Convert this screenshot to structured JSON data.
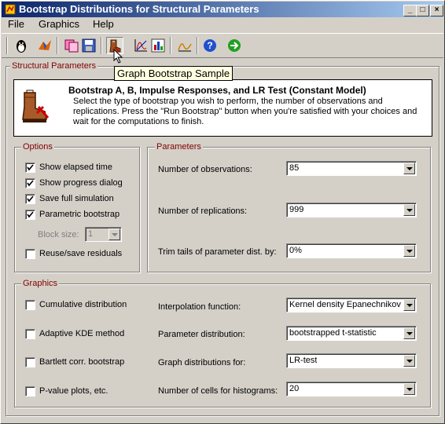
{
  "window": {
    "title": "Bootstrap Distributions for Structural Parameters",
    "controls": [
      "_",
      "□",
      "×"
    ]
  },
  "menu": [
    "File",
    "Graphics",
    "Help"
  ],
  "toolbar": {
    "icons": [
      "penguin-icon",
      "matlab-icon",
      "copy-icon",
      "save-icon",
      "bootstrap-icon",
      "graph-icon",
      "chart-icon",
      "distribution-icon",
      "help-icon",
      "run-icon"
    ],
    "tooltip": "Graph Bootstrap Sample"
  },
  "structural": {
    "group_label": "Structural Parameters",
    "title": "Bootstrap A, B, Impulse Responses, and LR Test (Constant Model)",
    "description": "Select the type of bootstrap you wish to perform, the number of observations and replications. Press the \"Run Bootstrap\" button when you're satisfied with your choices and wait for the computations to finish."
  },
  "options": {
    "group_label": "Options",
    "items": [
      {
        "label": "Show elapsed time",
        "checked": true
      },
      {
        "label": "Show progress dialog",
        "checked": true
      },
      {
        "label": "Save full simulation",
        "checked": true
      },
      {
        "label": "Parametric bootstrap",
        "checked": true
      }
    ],
    "block_size_label": "Block size:",
    "block_size_value": "1",
    "reuse_label": "Reuse/save residuals",
    "reuse_checked": false
  },
  "parameters": {
    "group_label": "Parameters",
    "fields": [
      {
        "label": "Number of observations:",
        "value": "85"
      },
      {
        "label": "Number of replications:",
        "value": "999"
      },
      {
        "label": "Trim tails of parameter dist. by:",
        "value": "0%"
      }
    ]
  },
  "graphics": {
    "group_label": "Graphics",
    "checkboxes": [
      {
        "label": "Cumulative distribution",
        "checked": false
      },
      {
        "label": "Adaptive KDE method",
        "checked": false
      },
      {
        "label": "Bartlett corr. bootstrap",
        "checked": false
      },
      {
        "label": "P-value plots, etc.",
        "checked": false
      }
    ],
    "fields": [
      {
        "label": "Interpolation function:",
        "value": "Kernel density Epanechnikov"
      },
      {
        "label": "Parameter distribution:",
        "value": "bootstrapped t-statistic"
      },
      {
        "label": "Graph distributions for:",
        "value": "LR-test"
      },
      {
        "label": "Number of cells for histograms:",
        "value": "20"
      }
    ]
  }
}
